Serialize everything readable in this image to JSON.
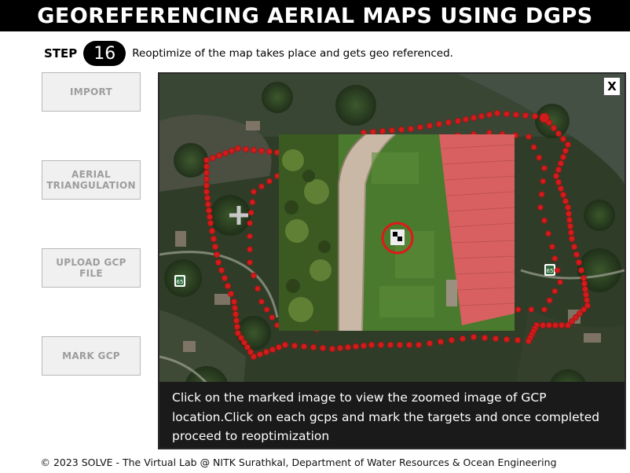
{
  "header": {
    "title": "GEOREFERENCING AERIAL MAPS USING DGPS"
  },
  "step": {
    "label": "STEP",
    "number": "16",
    "description": "Reoptimize of the map takes place and gets geo referenced."
  },
  "sidebar": {
    "buttons": [
      {
        "label": "IMPORT"
      },
      {
        "label_line1": "AERIAL",
        "label_line2": "TRIANGULATION"
      },
      {
        "label_line1": "UPLOAD GCP",
        "label_line2": "FILE"
      },
      {
        "label": "MARK GCP"
      }
    ]
  },
  "map": {
    "road_sign_left": "65",
    "road_sign_right": "65",
    "close_label": "X",
    "colors": {
      "gcp_marker": "#d01c1c",
      "roof": "#d96060",
      "grass": "#4a7a2e",
      "path": "#c9b8a6"
    }
  },
  "instruction": {
    "text": "Click on the marked image to view the zoomed image of GCP location.Click on each gcps and mark the targets and once completed proceed to reoptimization"
  },
  "footer": {
    "text": "© 2023 SOLVE - The Virtual Lab @ NITK Surathkal, Department of Water Resources & Ocean Engineering"
  }
}
